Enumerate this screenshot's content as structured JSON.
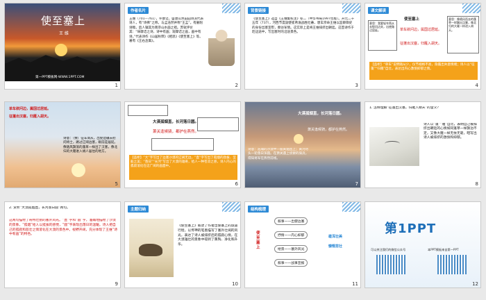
{
  "slides": [
    {
      "num": "1",
      "title": "使至塞上",
      "author": "王 维",
      "footer": "第一PPT模板网-WWW.1PPT.COM"
    },
    {
      "num": "2",
      "tag": "作者名片",
      "text": "王维（701—761），字摩诘，盛唐山水田园诗派代表诗人，有“诗佛”之称。与孟浩然并称“王孟”。有删削诗稿，后人辑其为南宗山水画之祖。苏轼评价其：“味摩诘之诗，诗中有画；观摩诘之画，画中有诗。”代表诗作《山居秋暝》《相思》《使至塞上》等。著有《王右丞集》。"
    },
    {
      "num": "3",
      "tag": "背景链接",
      "text": "《使至塞上》选自《王维集校注》卷二（中华书局1997年版）。开元二十五年（737），河西节度副使崔希逸战胜吐蕃，唐玄宗命王维以监察御史的身份出塞宣慰，察访军情。这实际上是将王维排挤出朝廷。这首诗作于赴边途中，写出塞时的沿途景色。"
    },
    {
      "num": "4",
      "tag": "课文解读",
      "lines": [
        "单车欲问边，属国过居延。",
        "征蓬出汉塞，归雁入胡天。",
        "使至塞上"
      ],
      "note1": "意思：我要轻车简从去慰问边关，出使路过居延。",
      "note2": "意思：像随风而去的蓬草一样飘出汉塞，像北归的大雁一样进入胡天。",
      "orange": "【品析】“单车”说明随从少，仪节规格不高，隐露出失意情绪；诗人以“征蓬”“归雁”自比，表达出内心激愤抑郁之情。"
    },
    {
      "num": "5",
      "lines": [
        "单车欲问边，属国过居延。",
        "征蓬出汉塞，归雁入胡天。"
      ],
      "poem": "诗意：（致）征车简从，出使边疆去慰问将士，路过辽阔边塞，眼前是居延。像随风飘荡的蓬草一样出了汉塞，像北归的大雁进入胡人居住的地方。"
    },
    {
      "num": "6",
      "lines": [
        "大漠孤烟直，长河落日圆。",
        "萧关逢候骑，都护在燕然。"
      ],
      "note": "【品析】“大”字写出了边塞沙漠的辽阔无边，“直”字写出了孤烟的劲拔、坚毅之美；“落日”“长河”写出了大漠的雄奇，给人一种苍凉之感，诗人内心的孤寂溶化在这广阔的画面中。"
    },
    {
      "num": "7",
      "lines": [
        "大漠孤烟直，长河落日圆。",
        "萧关逢候骑，都护在燕然。"
      ],
      "poem": "诗意：浩瀚的沙漠中一股黄烟直上；黄河尽头一轮落日浑圆。在萧关遇上侦察的骑兵，得知将军在燕然前线。"
    },
    {
      "num": "8",
      "question": "1. 怎样理解“征蓬出汉塞，归雁入胡天”的含义？",
      "answer": "诗人以“蓬”“雁”自比，表明自己被排挤出朝廷的心情如同蓬草一样飘泊不定，又像大雁一样无依无靠，暗写出诗人被排挤的激愤和抑郁。"
    },
    {
      "num": "9",
      "question": "2. 赏析“大漠孤烟直，长河落日圆”两句。",
      "answer": "这两句描绘了奇特壮丽的塞外风光。“直”字和“圆”字，准确地描绘了沙漠的景象，“孤烟”给人以挺拔的感觉，“圆”字表现出落日的温暖。诗人把自己的孤寂和悲壮之情溶化在大漠的景色中。视野开阔，充分体现了王维“诗中有画”的特色。"
    },
    {
      "num": "10",
      "tag": "主题归纳",
      "text": "《使至塞上》叙述了作者出使塞上的旅途行程，以传神的笔墨描写了塞外壮阔的风光，表达了诗人被排挤后的孤寂心情，在大漠雄壮的景象中得到了熏陶、净化和升华。"
    },
    {
      "num": "11",
      "tag": "结构梳理",
      "center": "使至塞上",
      "items": [
        "叙事——出使边塞",
        "抒情——内心抑郁",
        "绘景——塞外风光",
        "叙事——战事宣报"
      ],
      "right1": "雄浑壮美",
      "right2": "慷慨悲壮"
    },
    {
      "num": "12",
      "logo": "第1PPT",
      "footer1": "可以关注我们的微信公众号",
      "footer2": "本PPT模板来自第一PPT"
    }
  ]
}
